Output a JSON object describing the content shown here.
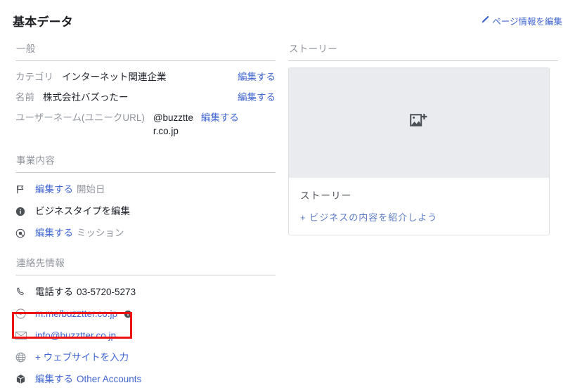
{
  "header": {
    "title": "基本データ",
    "edit_page_link": "ページ情報を編集",
    "pencil_icon": "pencil-icon"
  },
  "colors": {
    "link_blue": "#4267d2",
    "label_gray": "#90949c",
    "text_dark": "#1d2129",
    "divider": "#ccd0d5",
    "highlight_red": "#ee1111",
    "thumb_bg": "#e9ebee"
  },
  "left_column": {
    "general": {
      "heading": "一般",
      "rows": [
        {
          "label": "カテゴリ",
          "value": "インターネット関連企業",
          "edit": "編集する"
        },
        {
          "label": "名前",
          "value": "株式会社バズったー",
          "edit": "編集する"
        },
        {
          "label": "ユーザーネーム(ユニークURL)",
          "value": "@buzztter.co.jp",
          "edit": "編集する"
        }
      ]
    },
    "business": {
      "heading": "事業内容",
      "rows": [
        {
          "icon": "flag-icon",
          "link": "編集する",
          "text": "開始日"
        },
        {
          "icon": "info-circle-icon",
          "link": "",
          "text": "ビジネスタイプを編集"
        },
        {
          "icon": "target-icon",
          "link": "編集する",
          "text": "ミッション"
        }
      ]
    },
    "contact": {
      "heading": "連絡先情報",
      "rows": [
        {
          "icon": "phone-icon",
          "link": "電話する",
          "text": "03-5720-5273",
          "badge": ""
        },
        {
          "icon": "messenger-icon",
          "link": "m.me/buzztter.co.jp",
          "text": "",
          "badge": "info-badge-icon"
        },
        {
          "icon": "envelope-icon",
          "link": "info@buzztter.co.jp",
          "text": "",
          "badge": ""
        },
        {
          "icon": "globe-icon",
          "link": "+ ウェブサイトを入力",
          "text": "",
          "badge": ""
        },
        {
          "icon": "cube-icon",
          "link": "編集する",
          "text": "Other Accounts",
          "badge": ""
        }
      ],
      "highlighted_row_index": 2
    }
  },
  "right_column": {
    "story": {
      "heading": "ストーリー",
      "thumb_icon": "add-photo-icon",
      "card_title": "ストーリー",
      "add_link": "+ ビジネスの内容を紹介しよう"
    }
  }
}
